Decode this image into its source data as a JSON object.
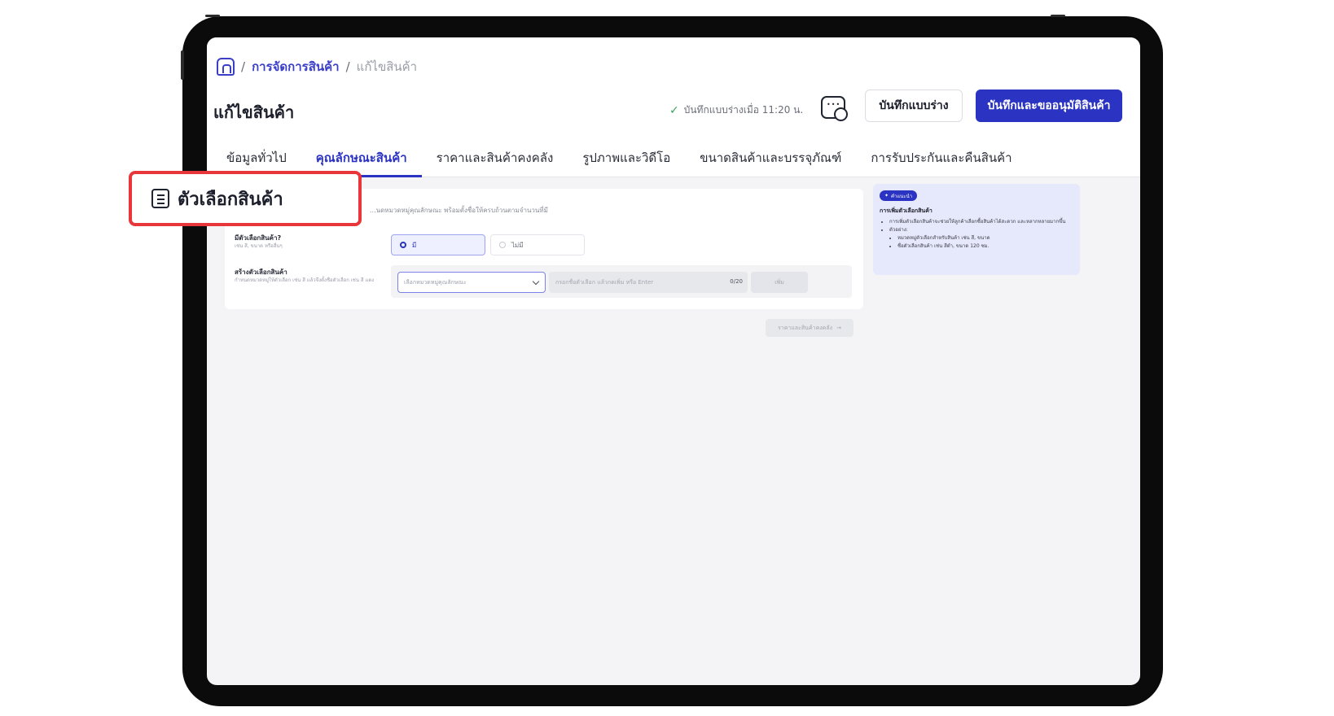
{
  "breadcrumb": {
    "separator": "/",
    "items": [
      "การจัดการสินค้า",
      "แก้ไขสินค้า"
    ]
  },
  "page": {
    "title": "แก้ไขสินค้า"
  },
  "header": {
    "saved_status": "บันทึกแบบร่างเมื่อ 11:20 น.",
    "draft_button": "บันทึกแบบร่าง",
    "approve_button": "บันทึกและขออนุมัติสินค้า"
  },
  "tabs": [
    {
      "label": "ข้อมูลทั่วไป"
    },
    {
      "label": "คุณลักษณะสินค้า"
    },
    {
      "label": "ราคาและสินค้าคงคลัง"
    },
    {
      "label": "รูปภาพและวิดีโอ"
    },
    {
      "label": "ขนาดสินค้าและบรรจุภัณฑ์"
    },
    {
      "label": "การรับประกันและคืนสินค้า"
    }
  ],
  "active_tab": "คุณลักษณะสินค้า",
  "section": {
    "title": "ตัวเลือกสินค้า",
    "description": "...นดหมวดหมู่คุณลักษณะ พร้อมตั้งชื่อให้ครบถ้วนตามจำนวนที่มี",
    "has_options_label": "มีตัวเลือกสินค้า?",
    "has_options_sub": "เช่น สี, ขนาด หรืออื่นๆ",
    "option_yes": "มี",
    "option_no": "ไม่มี",
    "create_label": "สร้างตัวเลือกสินค้า",
    "create_sub": "กำหนดหมวดหมู่ให้ตัวเลือก เช่น สี แล้วจึงตั้งชื่อตัวเลือก เช่น สี แดง",
    "select_placeholder": "เลือกหมวดหมู่คุณลักษณะ",
    "option_input_placeholder": "กรอกชื่อตัวเลือก แล้วกดเพิ่ม หรือ Enter",
    "counter": "0/20",
    "add_button": "เพิ่ม",
    "next_button": "ราคาและสินค้าคงคลัง"
  },
  "tip": {
    "badge": "คำแนะนำ",
    "title": "การเพิ่มตัวเลือกสินค้า",
    "point1": "การเพิ่มตัวเลือกสินค้าจะช่วยให้ลูกค้าเลือกซื้อสินค้าได้สะดวก และหลากหลายมากขึ้น",
    "point2": "ตัวอย่าง:",
    "example1": "หมวดหมู่ตัวเลือกสำหรับสินค้า เช่น สี, ขนาด",
    "example2": "ชื่อตัวเลือกสินค้า เช่น สีดำ, ขนาด 120 ซม."
  },
  "colors": {
    "accent": "#2b33c3",
    "highlight_border": "#e9363a",
    "frame": "#0b0b0c"
  }
}
